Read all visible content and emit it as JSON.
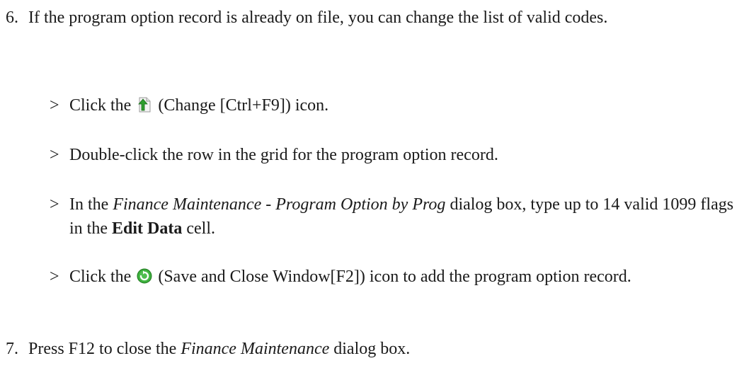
{
  "step6": {
    "number": "6.",
    "text": "If the program option record is already on file, you can change the list of valid codes."
  },
  "substeps": [
    {
      "arrow": ">",
      "pre": "Click the",
      "icon": "change-icon",
      "post": "(Change [Ctrl+F9]) icon."
    },
    {
      "arrow": ">",
      "text": "Double-click the row in the grid for the program option record."
    },
    {
      "arrow": ">",
      "pre": "In the",
      "dialog": "Finance Maintenance - Program Option by Prog",
      "mid": "dialog box, type up to 14 valid 1099 flags in the",
      "bold": "Edit Data",
      "post": "cell."
    },
    {
      "arrow": ">",
      "pre": "Click the",
      "icon": "save-close-icon",
      "post": "(Save and Close Window[F2]) icon to add the program option record."
    }
  ],
  "step7": {
    "number": "7.",
    "pre": "Press F12 to close the",
    "dialog": "Finance Maintenance",
    "post": "dialog box."
  },
  "colors": {
    "text": "#1a1a1a",
    "change_icon_green": "#2e9e2e",
    "save_icon_green": "#3cae3c"
  }
}
